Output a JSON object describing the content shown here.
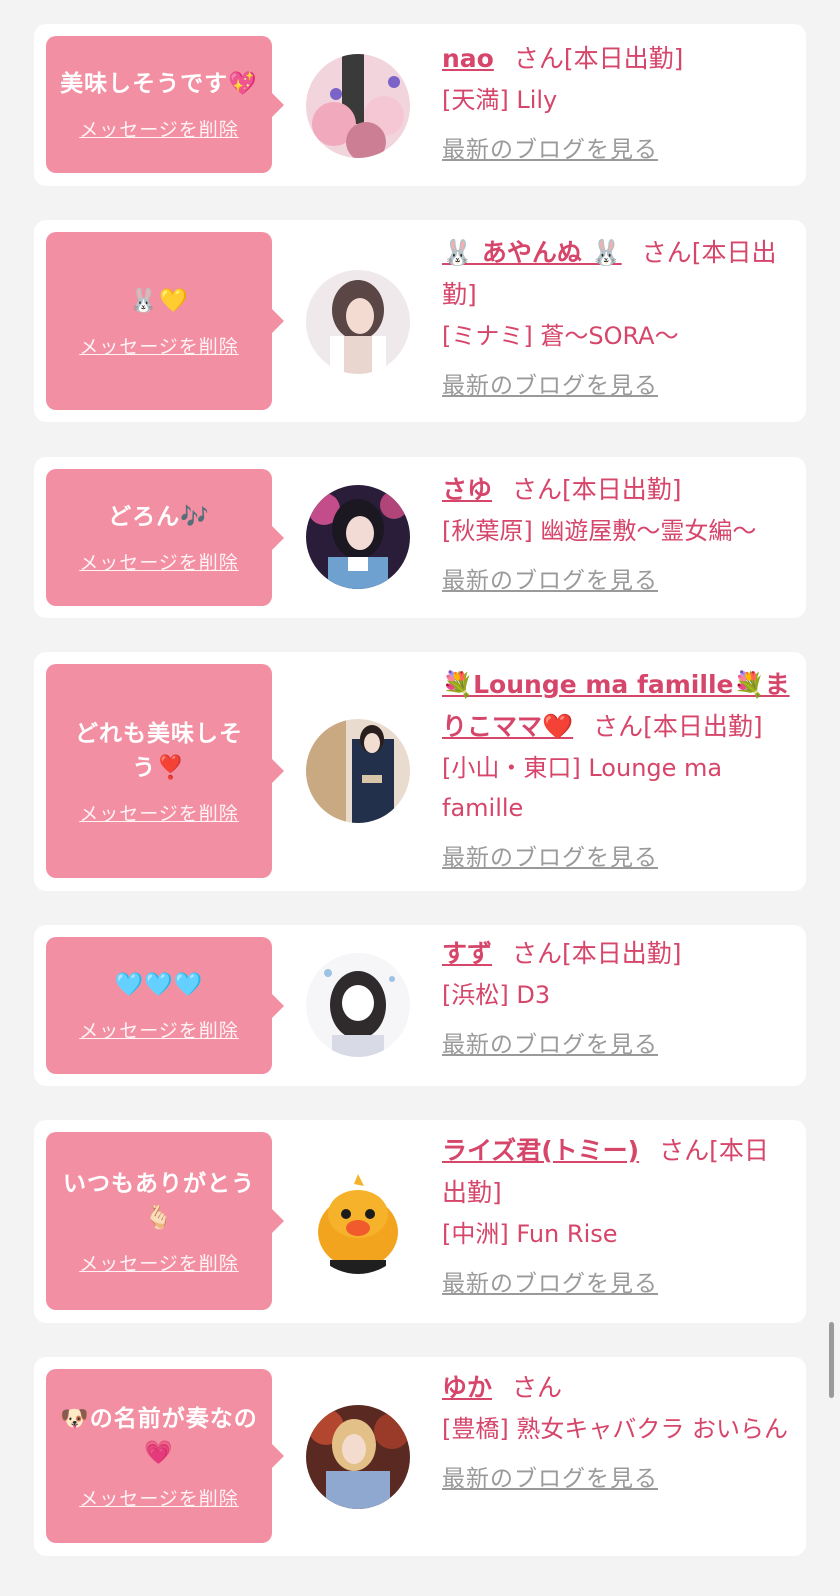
{
  "delete_label": "メッセージを削除",
  "blog_label": "最新のブログを見る",
  "name_suffix": "さん",
  "attendance_label": "[本日出勤]",
  "cards": [
    {
      "message": "美味しそうです💖",
      "name": "nao",
      "attendance": true,
      "shop": "[天満] Lily"
    },
    {
      "message": "🐰💛",
      "name": "🐰 あやんぬ 🐰",
      "attendance": true,
      "shop": "[ミナミ] 蒼〜SORA〜"
    },
    {
      "message": "どろん🎶",
      "name": "さゆ",
      "attendance": true,
      "shop": "[秋葉原] 幽遊屋敷〜霊女編〜"
    },
    {
      "message": "どれも美味しそう❣️",
      "name": "💐Lounge ma famille💐まりこママ❤️",
      "attendance": true,
      "shop": "[小山・東口] Lounge ma famille"
    },
    {
      "message": "🩵🩵🩵",
      "name": "すず",
      "attendance": true,
      "shop": "[浜松] D3"
    },
    {
      "message": "いつもありがとう🫰🏻",
      "name": "ライズ君(トミー)",
      "attendance": true,
      "shop": "[中洲] Fun Rise"
    },
    {
      "message": "🐶の名前が奏なの💗",
      "name": "ゆか",
      "attendance": false,
      "shop": "[豊橋] 熟女キャバクラ おいらん"
    }
  ],
  "colors": {
    "accent": "#d6456a",
    "bubble": "#f38fa2",
    "background": "#f4f3f3",
    "link_gray": "#9a9a9a"
  }
}
